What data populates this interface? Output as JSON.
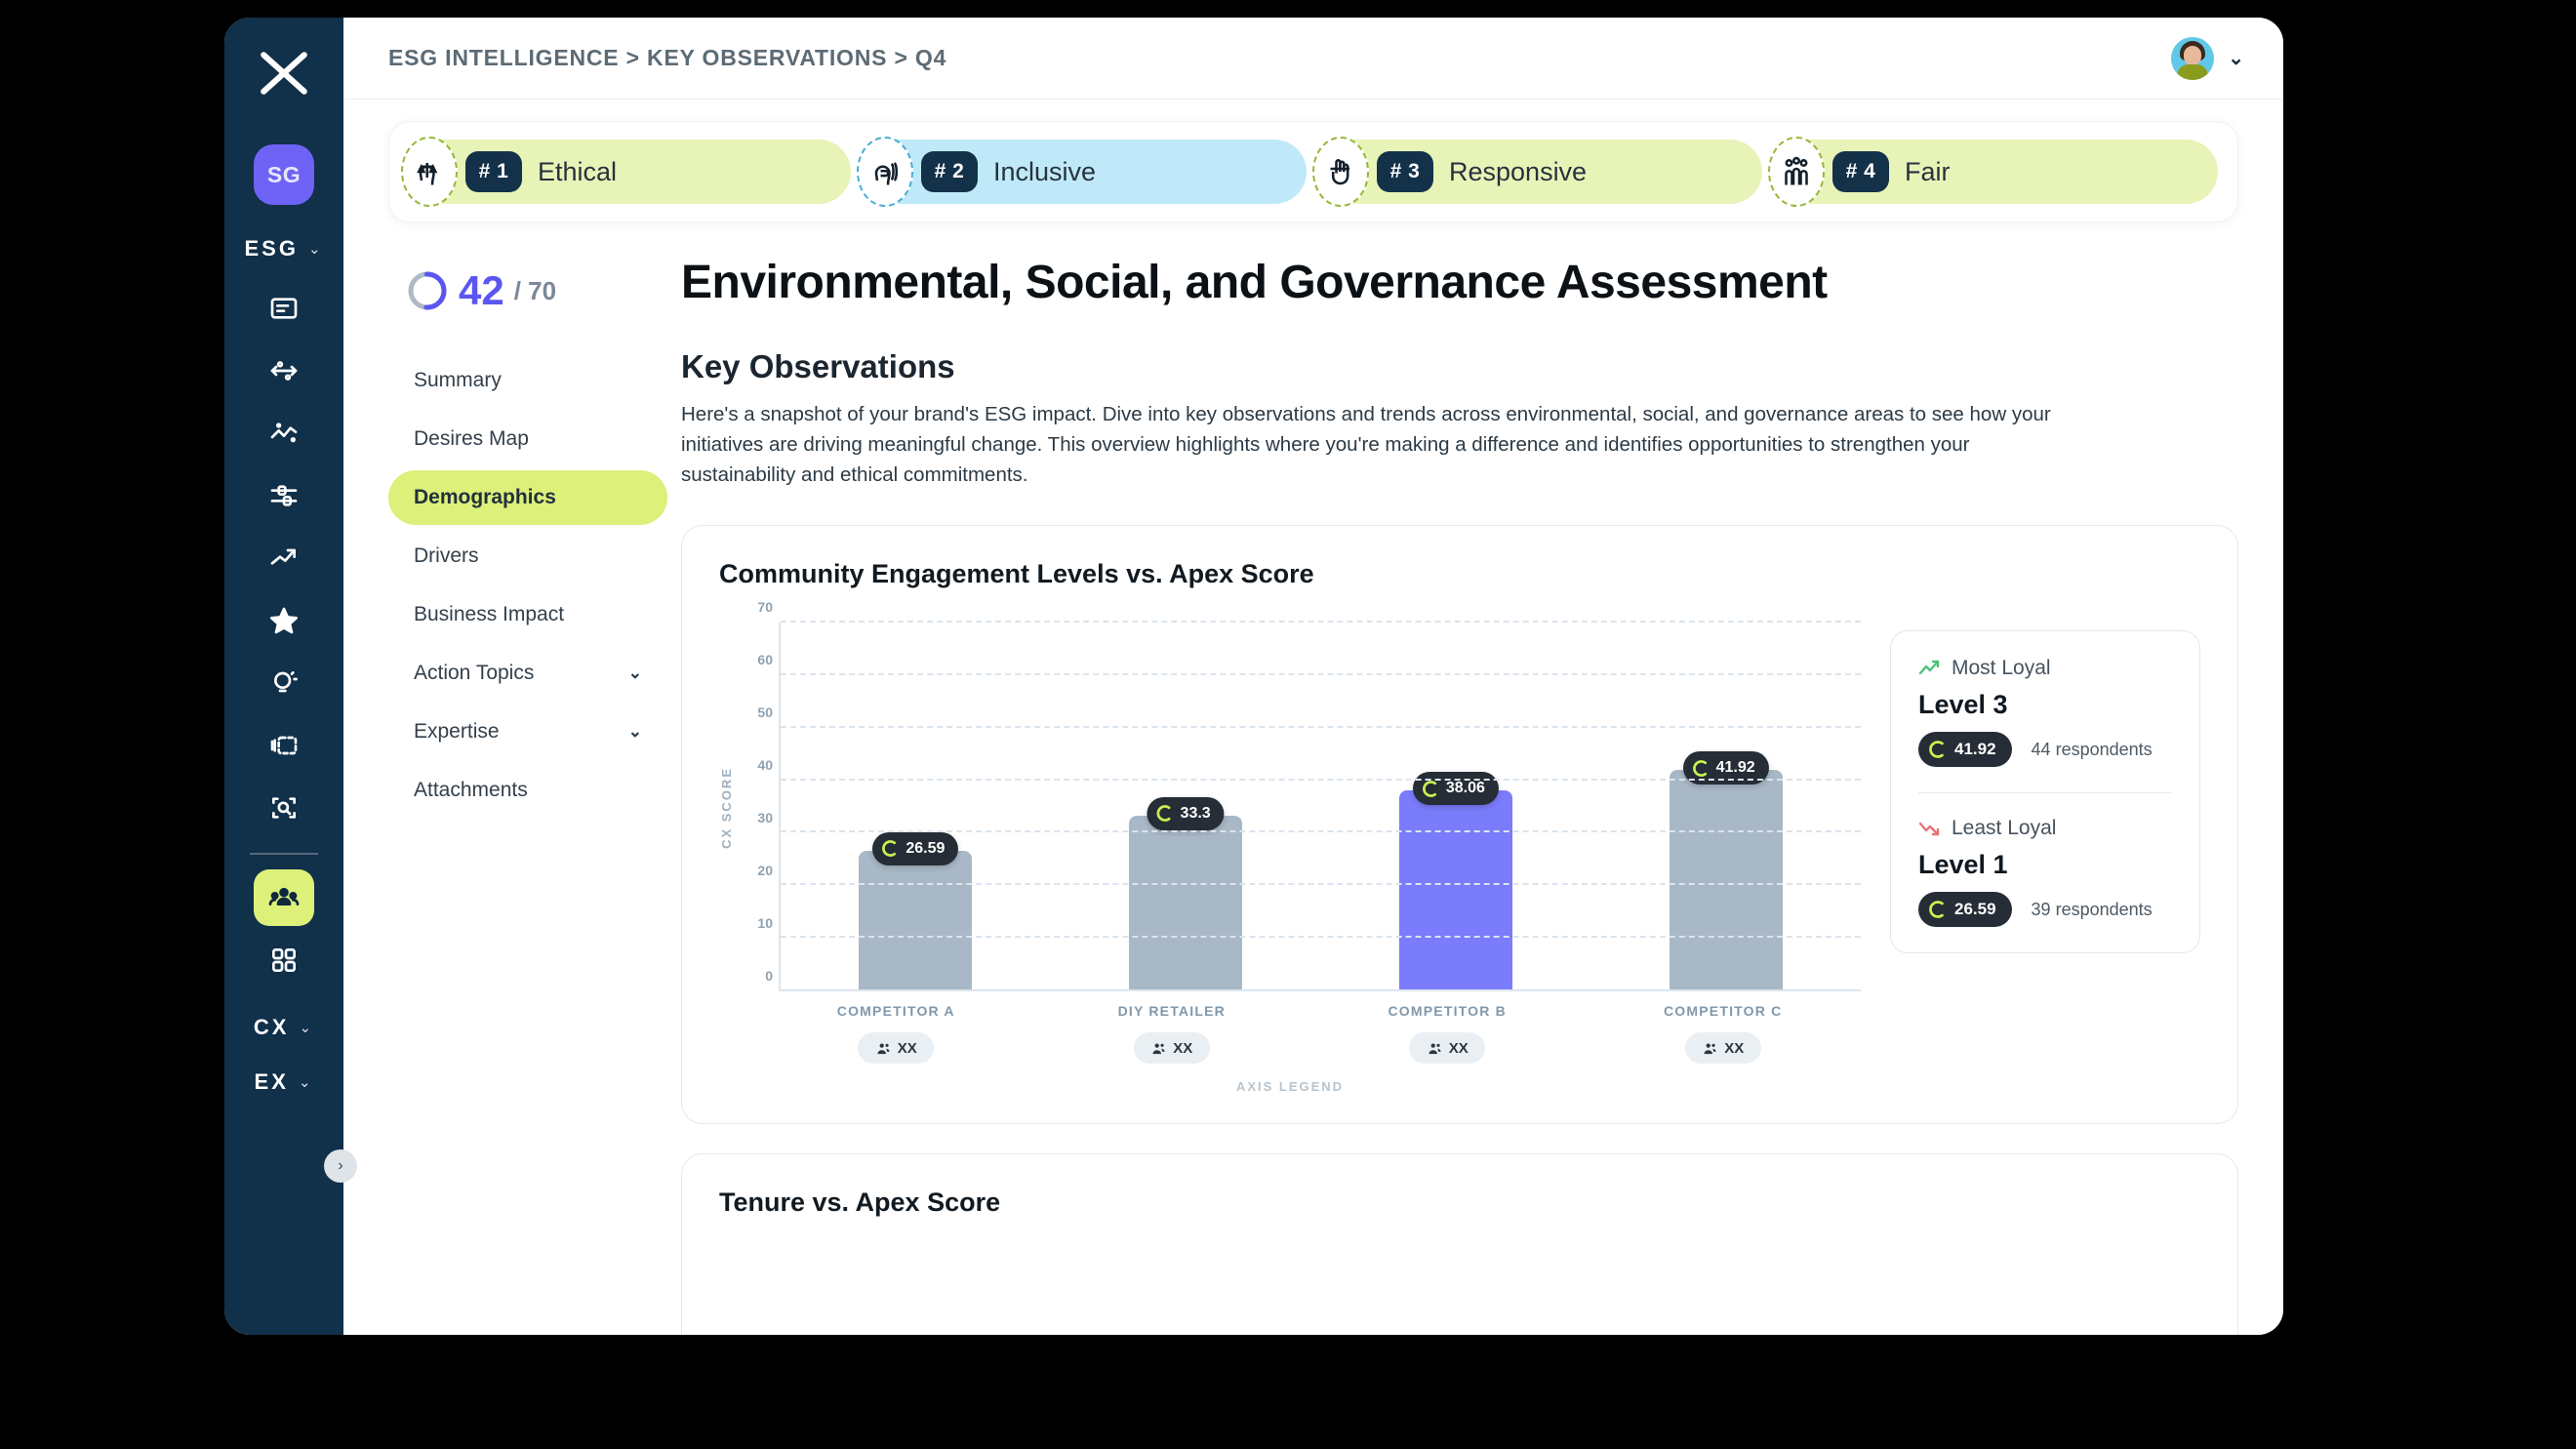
{
  "breadcrumb": "ESG INTELLIGENCE > KEY OBSERVATIONS > Q4",
  "sidebar": {
    "logo": "x-logo",
    "user_initials": "SG",
    "group_label": "ESG",
    "group_chevron": "⌄",
    "icons": [
      {
        "name": "document-icon"
      },
      {
        "name": "distribution-icon"
      },
      {
        "name": "sparkline-icon"
      },
      {
        "name": "filter-sliders-icon"
      },
      {
        "name": "trend-up-icon"
      },
      {
        "name": "star-icon"
      },
      {
        "name": "lightbulb-icon"
      },
      {
        "name": "layers-icon"
      },
      {
        "name": "scan-search-icon"
      }
    ],
    "active_icon": "people-group-icon",
    "grid_icon": "grid-apps-icon",
    "groups_bottom": [
      {
        "label": "CX",
        "chevron": "⌄"
      },
      {
        "label": "EX",
        "chevron": "⌄"
      }
    ],
    "collapse_chevron": "›"
  },
  "topbar": {
    "avatar": "user-avatar-photo",
    "chevron": "⌄"
  },
  "chips": [
    {
      "num": "# 1",
      "label": "Ethical",
      "tone": "green",
      "icon": "scales-justice-head-icon"
    },
    {
      "num": "# 2",
      "label": "Inclusive",
      "tone": "blue",
      "icon": "inclusive-head-icon"
    },
    {
      "num": "# 3",
      "label": "Responsive",
      "tone": "green",
      "icon": "responsive-hand-icon"
    },
    {
      "num": "# 4",
      "label": "Fair",
      "tone": "green",
      "icon": "people-fair-icon"
    }
  ],
  "score": {
    "value": "42",
    "max": "/ 70",
    "value_num": 42,
    "max_num": 70
  },
  "nav": [
    {
      "label": "Summary",
      "active": false,
      "chevron": ""
    },
    {
      "label": "Desires Map",
      "active": false,
      "chevron": ""
    },
    {
      "label": "Demographics",
      "active": true,
      "chevron": ""
    },
    {
      "label": "Drivers",
      "active": false,
      "chevron": ""
    },
    {
      "label": "Business Impact",
      "active": false,
      "chevron": ""
    },
    {
      "label": "Action Topics",
      "active": false,
      "chevron": "⌄"
    },
    {
      "label": "Expertise",
      "active": false,
      "chevron": "⌄"
    },
    {
      "label": "Attachments",
      "active": false,
      "chevron": ""
    }
  ],
  "page_title": "Environmental, Social, and Governance Assessment",
  "section_title": "Key Observations",
  "intro_text": "Here's a snapshot of your brand's ESG impact. Dive into key observations and trends across environmental, social, and governance areas to see how your initiatives are driving meaningful change. This overview highlights where you're making a difference and identifies opportunities to strengthen your sustainability and ethical commitments.",
  "chart_data": {
    "type": "bar",
    "title": "Community Engagement Levels vs. Apex Score",
    "xlabel": "AXIS LEGEND",
    "ylabel": "CX SCORE",
    "ylim": [
      0,
      70
    ],
    "yticks": [
      70,
      60,
      50,
      40,
      30,
      20,
      10,
      0
    ],
    "grid": true,
    "categories": [
      "COMPETITOR A",
      "DIY RETAILER",
      "COMPETITOR B",
      "COMPETITOR C"
    ],
    "values": [
      26.59,
      33.3,
      38.06,
      41.92
    ],
    "value_labels": [
      "26.59",
      "33.3",
      "38.06",
      "41.92"
    ],
    "bar_colors": [
      "#a8b8c6",
      "#a8b8c6",
      "#7a7cfb",
      "#a8b8c6"
    ],
    "respondent_chips": [
      "XX",
      "XX",
      "XX",
      "XX"
    ],
    "legend_position": "right"
  },
  "loyalty": {
    "most": {
      "heading": "Most Loyal",
      "icon": "trend-up-green-icon",
      "level": "Level 3",
      "score": "41.92",
      "respondents": "44 respondents"
    },
    "least": {
      "heading": "Least Loyal",
      "icon": "trend-down-red-icon",
      "level": "Level 1",
      "score": "26.59",
      "respondents": "39 respondents"
    }
  },
  "card2": {
    "title": "Tenure vs. Apex Score"
  },
  "colors": {
    "sidebar_bg": "#11304a",
    "accent_lime": "#dcf07a",
    "accent_purple": "#7a7cfb",
    "bar_grey": "#a8b8c6",
    "chip_green": "#e8f3b8",
    "chip_blue": "#bfe9f8",
    "pill_dark": "#262d36",
    "score_purple": "#5b56f0",
    "trend_up_green": "#4ec27a",
    "trend_down_red": "#e8707a"
  }
}
